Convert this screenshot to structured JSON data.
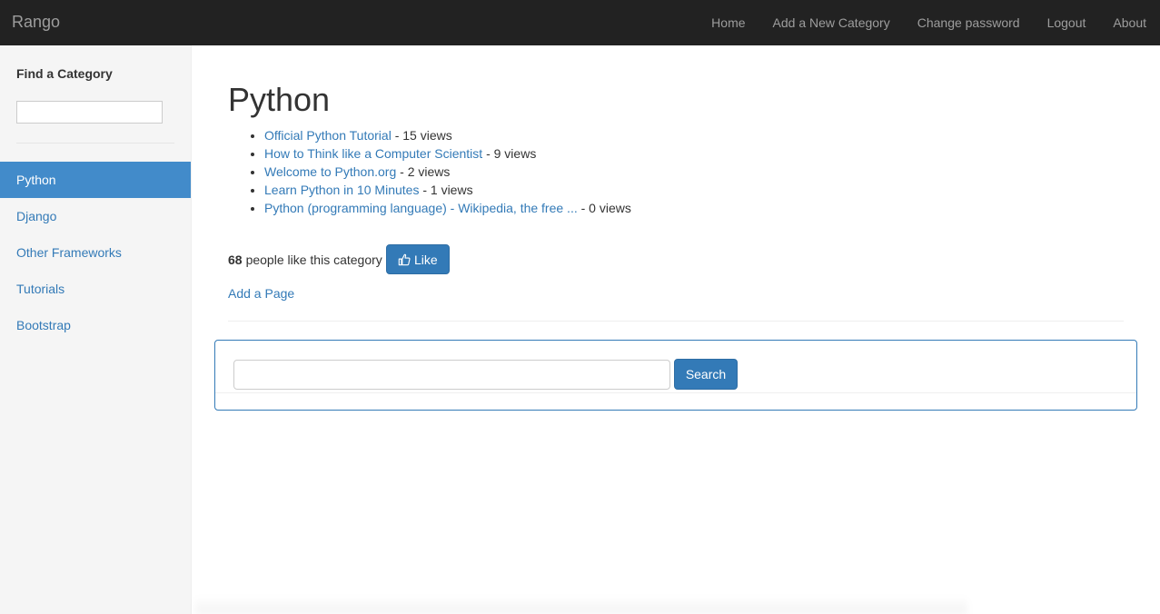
{
  "navbar": {
    "brand": "Rango",
    "links": [
      "Home",
      "Add a New Category",
      "Change password",
      "Logout",
      "About"
    ]
  },
  "sidebar": {
    "title": "Find a Category",
    "search_value": "",
    "categories": [
      "Python",
      "Django",
      "Other Frameworks",
      "Tutorials",
      "Bootstrap"
    ],
    "active": "Python"
  },
  "main": {
    "title": "Python",
    "pages": [
      {
        "title": "Official Python Tutorial",
        "views": "- 15 views"
      },
      {
        "title": "How to Think like a Computer Scientist",
        "views": "- 9 views"
      },
      {
        "title": "Welcome to Python.org",
        "views": "- 2 views"
      },
      {
        "title": "Learn Python in 10 Minutes",
        "views": "- 1 views"
      },
      {
        "title": "Python (programming language) - Wikipedia, the free ...",
        "views": "- 0 views"
      }
    ],
    "likes_count": "68",
    "likes_text": "people like this category",
    "like_button": "Like",
    "add_page": "Add a Page",
    "search_value": "",
    "search_button": "Search"
  },
  "colors": {
    "navbar_bg": "#222222",
    "link": "#337ab7",
    "active_bg": "#428bca",
    "sidebar_bg": "#f5f5f5"
  },
  "icons": {
    "like": "thumbs-up-icon"
  }
}
